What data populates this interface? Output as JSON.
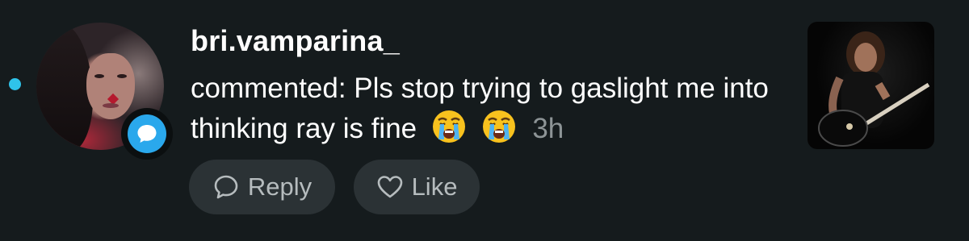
{
  "notification": {
    "unread": true,
    "username": "bri.vamparina_",
    "comment_prefix": "commented: Pls stop trying to gaslight me into thinking ray is fine",
    "emojis": [
      "loudly-crying-face",
      "loudly-crying-face"
    ],
    "timestamp": "3h",
    "avatar_badge_icon": "comment-bubble-icon"
  },
  "actions": {
    "reply_label": "Reply",
    "like_label": "Like"
  },
  "colors": {
    "background": "#151b1d",
    "unread_dot": "#2fc3ea",
    "badge": "#2aa8ec",
    "button_bg": "#2b3235",
    "button_text": "#b6bcbe",
    "timestamp": "#8d9496"
  }
}
